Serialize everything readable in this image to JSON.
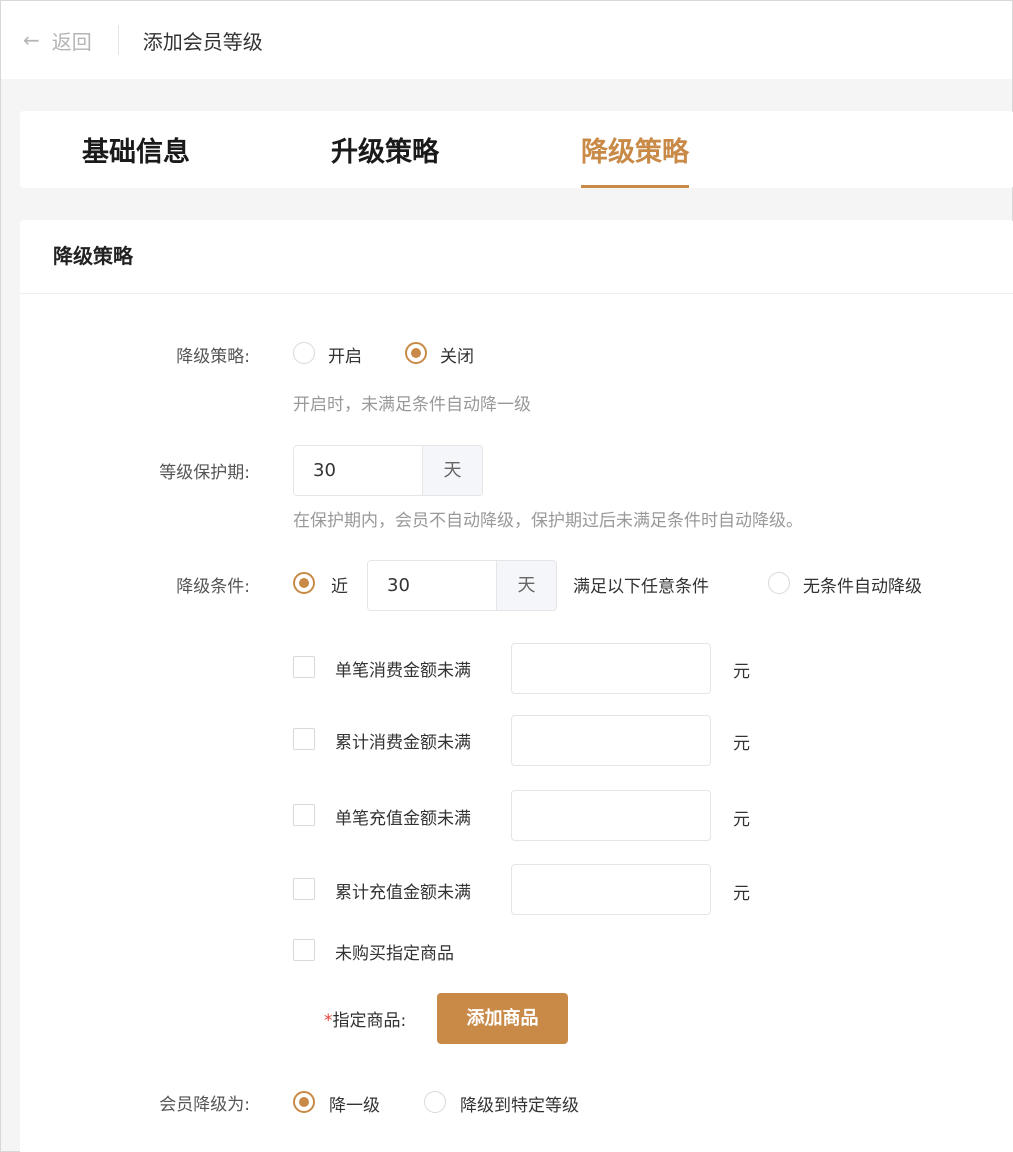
{
  "header": {
    "back_label": "返回",
    "title": "添加会员等级"
  },
  "tabs": [
    {
      "label": "基础信息"
    },
    {
      "label": "升级策略"
    },
    {
      "label": "降级策略",
      "active": true
    }
  ],
  "section": {
    "title": "降级策略"
  },
  "form": {
    "strategy": {
      "label": "降级策略:",
      "options": [
        {
          "label": "开启",
          "selected": false
        },
        {
          "label": "关闭",
          "selected": true
        }
      ],
      "hint": "开启时，未满足条件自动降一级"
    },
    "protection": {
      "label": "等级保护期:",
      "value": "30",
      "unit": "天",
      "hint": "在保护期内，会员不自动降级，保护期过后未满足条件时自动降级。"
    },
    "condition": {
      "label": "降级条件:",
      "near_label": "近",
      "days_value": "30",
      "days_unit": "天",
      "satisfy_text": "满足以下任意条件",
      "no_condition_label": "无条件自动降级",
      "items": [
        {
          "label": "单笔消费金额未满",
          "unit": "元",
          "value": ""
        },
        {
          "label": "累计消费金额未满",
          "unit": "元",
          "value": ""
        },
        {
          "label": "单笔充值金额未满",
          "unit": "元",
          "value": ""
        },
        {
          "label": "累计充值金额未满",
          "unit": "元",
          "value": ""
        }
      ],
      "product_check_label": "未购买指定商品",
      "product_label_required": "*",
      "product_label": "指定商品:",
      "add_product_button": "添加商品"
    },
    "downgrade_to": {
      "label": "会员降级为:",
      "options": [
        {
          "label": "降一级",
          "selected": true
        },
        {
          "label": "降级到特定等级",
          "selected": false
        }
      ]
    }
  },
  "colors": {
    "accent": "#c98a48",
    "required": "#e0443c"
  },
  "icons": {
    "back": "arrow-left-icon"
  }
}
